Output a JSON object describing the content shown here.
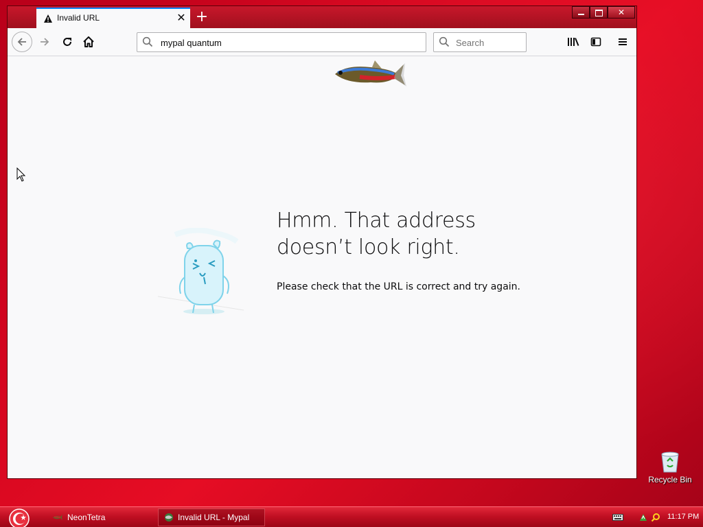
{
  "browser": {
    "tab": {
      "title": "Invalid URL",
      "icon": "warning-icon"
    },
    "urlbar": {
      "value": "mypal quantum"
    },
    "searchbar": {
      "placeholder": "Search"
    }
  },
  "content": {
    "title_line1": "Hmm. That address",
    "title_line2": "doesn’t look right.",
    "description": "Please check that the URL is correct and try again."
  },
  "desktop": {
    "recycle_bin_label": "Recycle Bin"
  },
  "taskbar": {
    "items": [
      {
        "label": "NeonTetra",
        "icon": "fish-icon"
      },
      {
        "label": "Invalid URL - Mypal",
        "icon": "mypal-icon"
      }
    ],
    "clock": "11:17 PM"
  },
  "colors": {
    "desktop": "#d4061f",
    "tab_accent": "#0a84ff",
    "page_bg": "#f9f9fa"
  }
}
